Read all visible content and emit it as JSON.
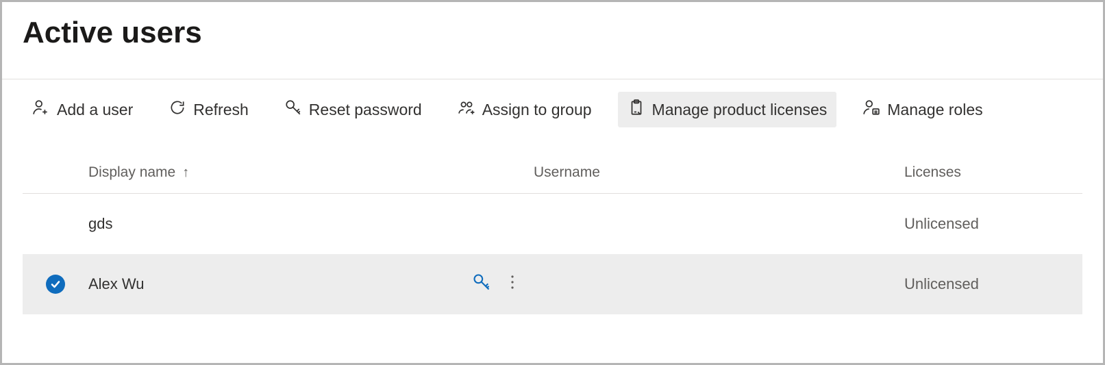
{
  "page": {
    "title": "Active users"
  },
  "toolbar": {
    "add_user": "Add a user",
    "refresh": "Refresh",
    "reset_password": "Reset password",
    "assign_to_group": "Assign to group",
    "manage_product_licenses": "Manage product licenses",
    "manage_roles": "Manage roles"
  },
  "columns": {
    "display_name": "Display name",
    "username": "Username",
    "licenses": "Licenses"
  },
  "rows": [
    {
      "display_name": "gds",
      "username": "",
      "licenses": "Unlicensed",
      "selected": false
    },
    {
      "display_name": "Alex Wu",
      "username": "",
      "licenses": "Unlicensed",
      "selected": true
    }
  ],
  "colors": {
    "accent": "#0f6cbd"
  }
}
